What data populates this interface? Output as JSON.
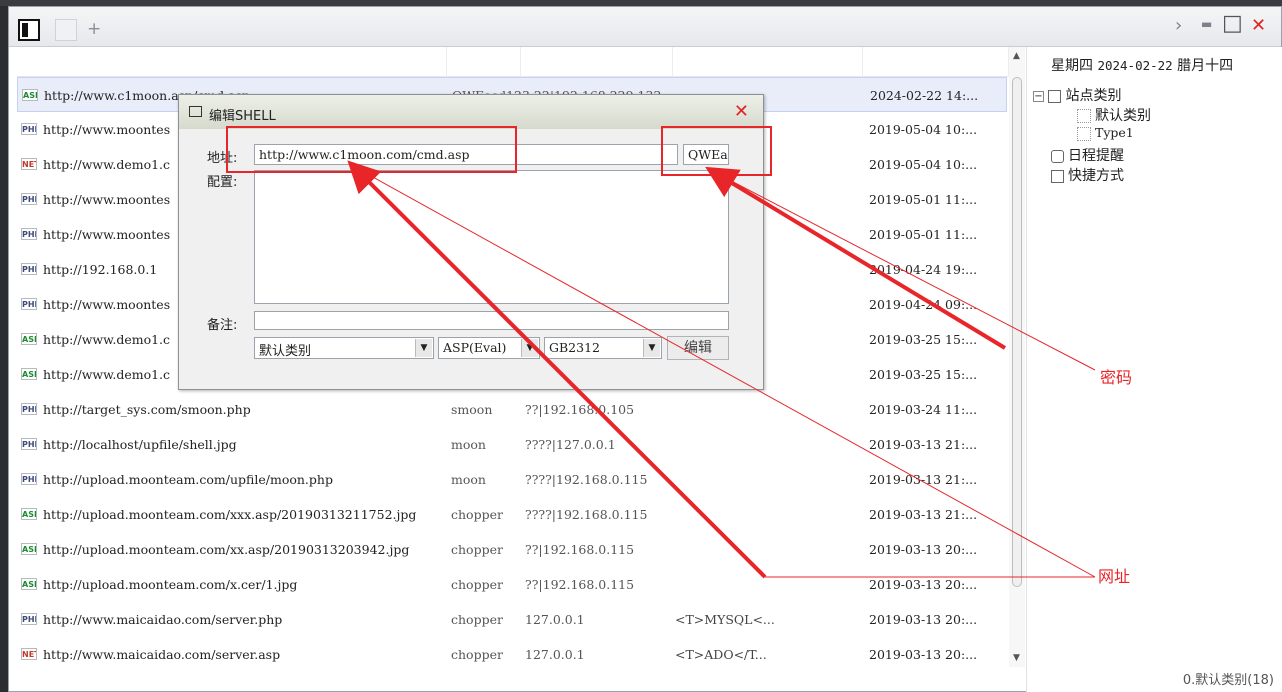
{
  "window": {
    "controls": {
      "next": "›",
      "minimize": "▬",
      "maximize": "□",
      "close": "✕"
    },
    "new_tab": "+"
  },
  "list": {
    "rows": [
      {
        "type": "ASP",
        "url": "http://www.c1moon.asp/cmd.asp",
        "note": "QWEasd123 22|192.168.229.132",
        "ip": "",
        "cfg": "",
        "time": "2024-02-22 14:..."
      },
      {
        "type": "PHP",
        "url": "http://www.moontes",
        "note": "",
        "ip": "",
        "cfg": "",
        "time": "2019-05-04 10:..."
      },
      {
        "type": "NET",
        "url": "http://www.demo1.c",
        "note": "",
        "ip": "",
        "cfg": "",
        "time": "2019-05-04 10:..."
      },
      {
        "type": "PHP",
        "url": "http://www.moontes",
        "note": "",
        "ip": "",
        "cfg": "",
        "time": "2019-05-01 11:..."
      },
      {
        "type": "PHP",
        "url": "http://www.moontes",
        "note": "",
        "ip": "",
        "cfg": "",
        "time": "2019-05-01 11:..."
      },
      {
        "type": "PHP",
        "url": "http://192.168.0.1",
        "note": "",
        "ip": "",
        "cfg": "",
        "time": "2019-04-24 19:..."
      },
      {
        "type": "PHP",
        "url": "http://www.moontes",
        "note": "",
        "ip": "",
        "cfg": "",
        "time": "2019-04-24 09:..."
      },
      {
        "type": "ASP",
        "url": "http://www.demo1.c",
        "note": "",
        "ip": "",
        "cfg": "",
        "time": "2019-03-25 15:..."
      },
      {
        "type": "ASP",
        "url": "http://www.demo1.c",
        "note": "",
        "ip": "",
        "cfg": "",
        "time": "2019-03-25 15:..."
      },
      {
        "type": "PHP",
        "url": "http://target_sys.com/smoon.php",
        "note": "smoon",
        "ip": "??|192.168.0.105",
        "cfg": "",
        "time": "2019-03-24 11:..."
      },
      {
        "type": "PHP",
        "url": "http://localhost/upfile/shell.jpg",
        "note": "moon",
        "ip": "????|127.0.0.1",
        "cfg": "",
        "time": "2019-03-13 21:..."
      },
      {
        "type": "PHP",
        "url": "http://upload.moonteam.com/upfile/moon.php",
        "note": "moon",
        "ip": "????|192.168.0.115",
        "cfg": "",
        "time": "2019-03-13 21:..."
      },
      {
        "type": "ASP",
        "url": "http://upload.moonteam.com/xxx.asp/20190313211752.jpg",
        "note": "chopper",
        "ip": "????|192.168.0.115",
        "cfg": "",
        "time": "2019-03-13 21:..."
      },
      {
        "type": "ASP",
        "url": "http://upload.moonteam.com/xx.asp/20190313203942.jpg",
        "note": "chopper",
        "ip": "??|192.168.0.115",
        "cfg": "",
        "time": "2019-03-13 20:..."
      },
      {
        "type": "ASP",
        "url": "http://upload.moonteam.com/x.cer/1.jpg",
        "note": "chopper",
        "ip": "??|192.168.0.115",
        "cfg": "",
        "time": "2019-03-13 20:..."
      },
      {
        "type": "PHP",
        "url": "http://www.maicaidao.com/server.php",
        "note": "chopper",
        "ip": "127.0.0.1",
        "cfg": "<T>MYSQL<...",
        "time": "2019-03-13 20:..."
      },
      {
        "type": "NET",
        "url": "http://www.maicaidao.com/server.asp",
        "note": "chopper",
        "ip": "127.0.0.1",
        "cfg": "<T>ADO</T...",
        "time": "2019-03-13 20:..."
      }
    ]
  },
  "sidebar": {
    "weekday": "星期四",
    "date": "2024-02-22",
    "lunar": "腊月十四",
    "tree": {
      "root": "站点类别",
      "children": [
        "默认类别",
        "Type1"
      ],
      "schedule": "日程提醒",
      "shortcuts": "快捷方式"
    },
    "status": "0.默认类别(18)"
  },
  "dialog": {
    "title": "编辑SHELL",
    "close": "✕",
    "address_label": "地址:",
    "address_value": "http://www.c1moon.com/cmd.asp",
    "password_value": "QWEas",
    "config_label": "配置:",
    "remark_label": "备注:",
    "remark_value": "",
    "category": "默认类别",
    "script_type": "ASP(Eval)",
    "encoding": "GB2312",
    "edit_button": "编辑"
  },
  "annotations": {
    "password": "密码",
    "url": "网址"
  }
}
